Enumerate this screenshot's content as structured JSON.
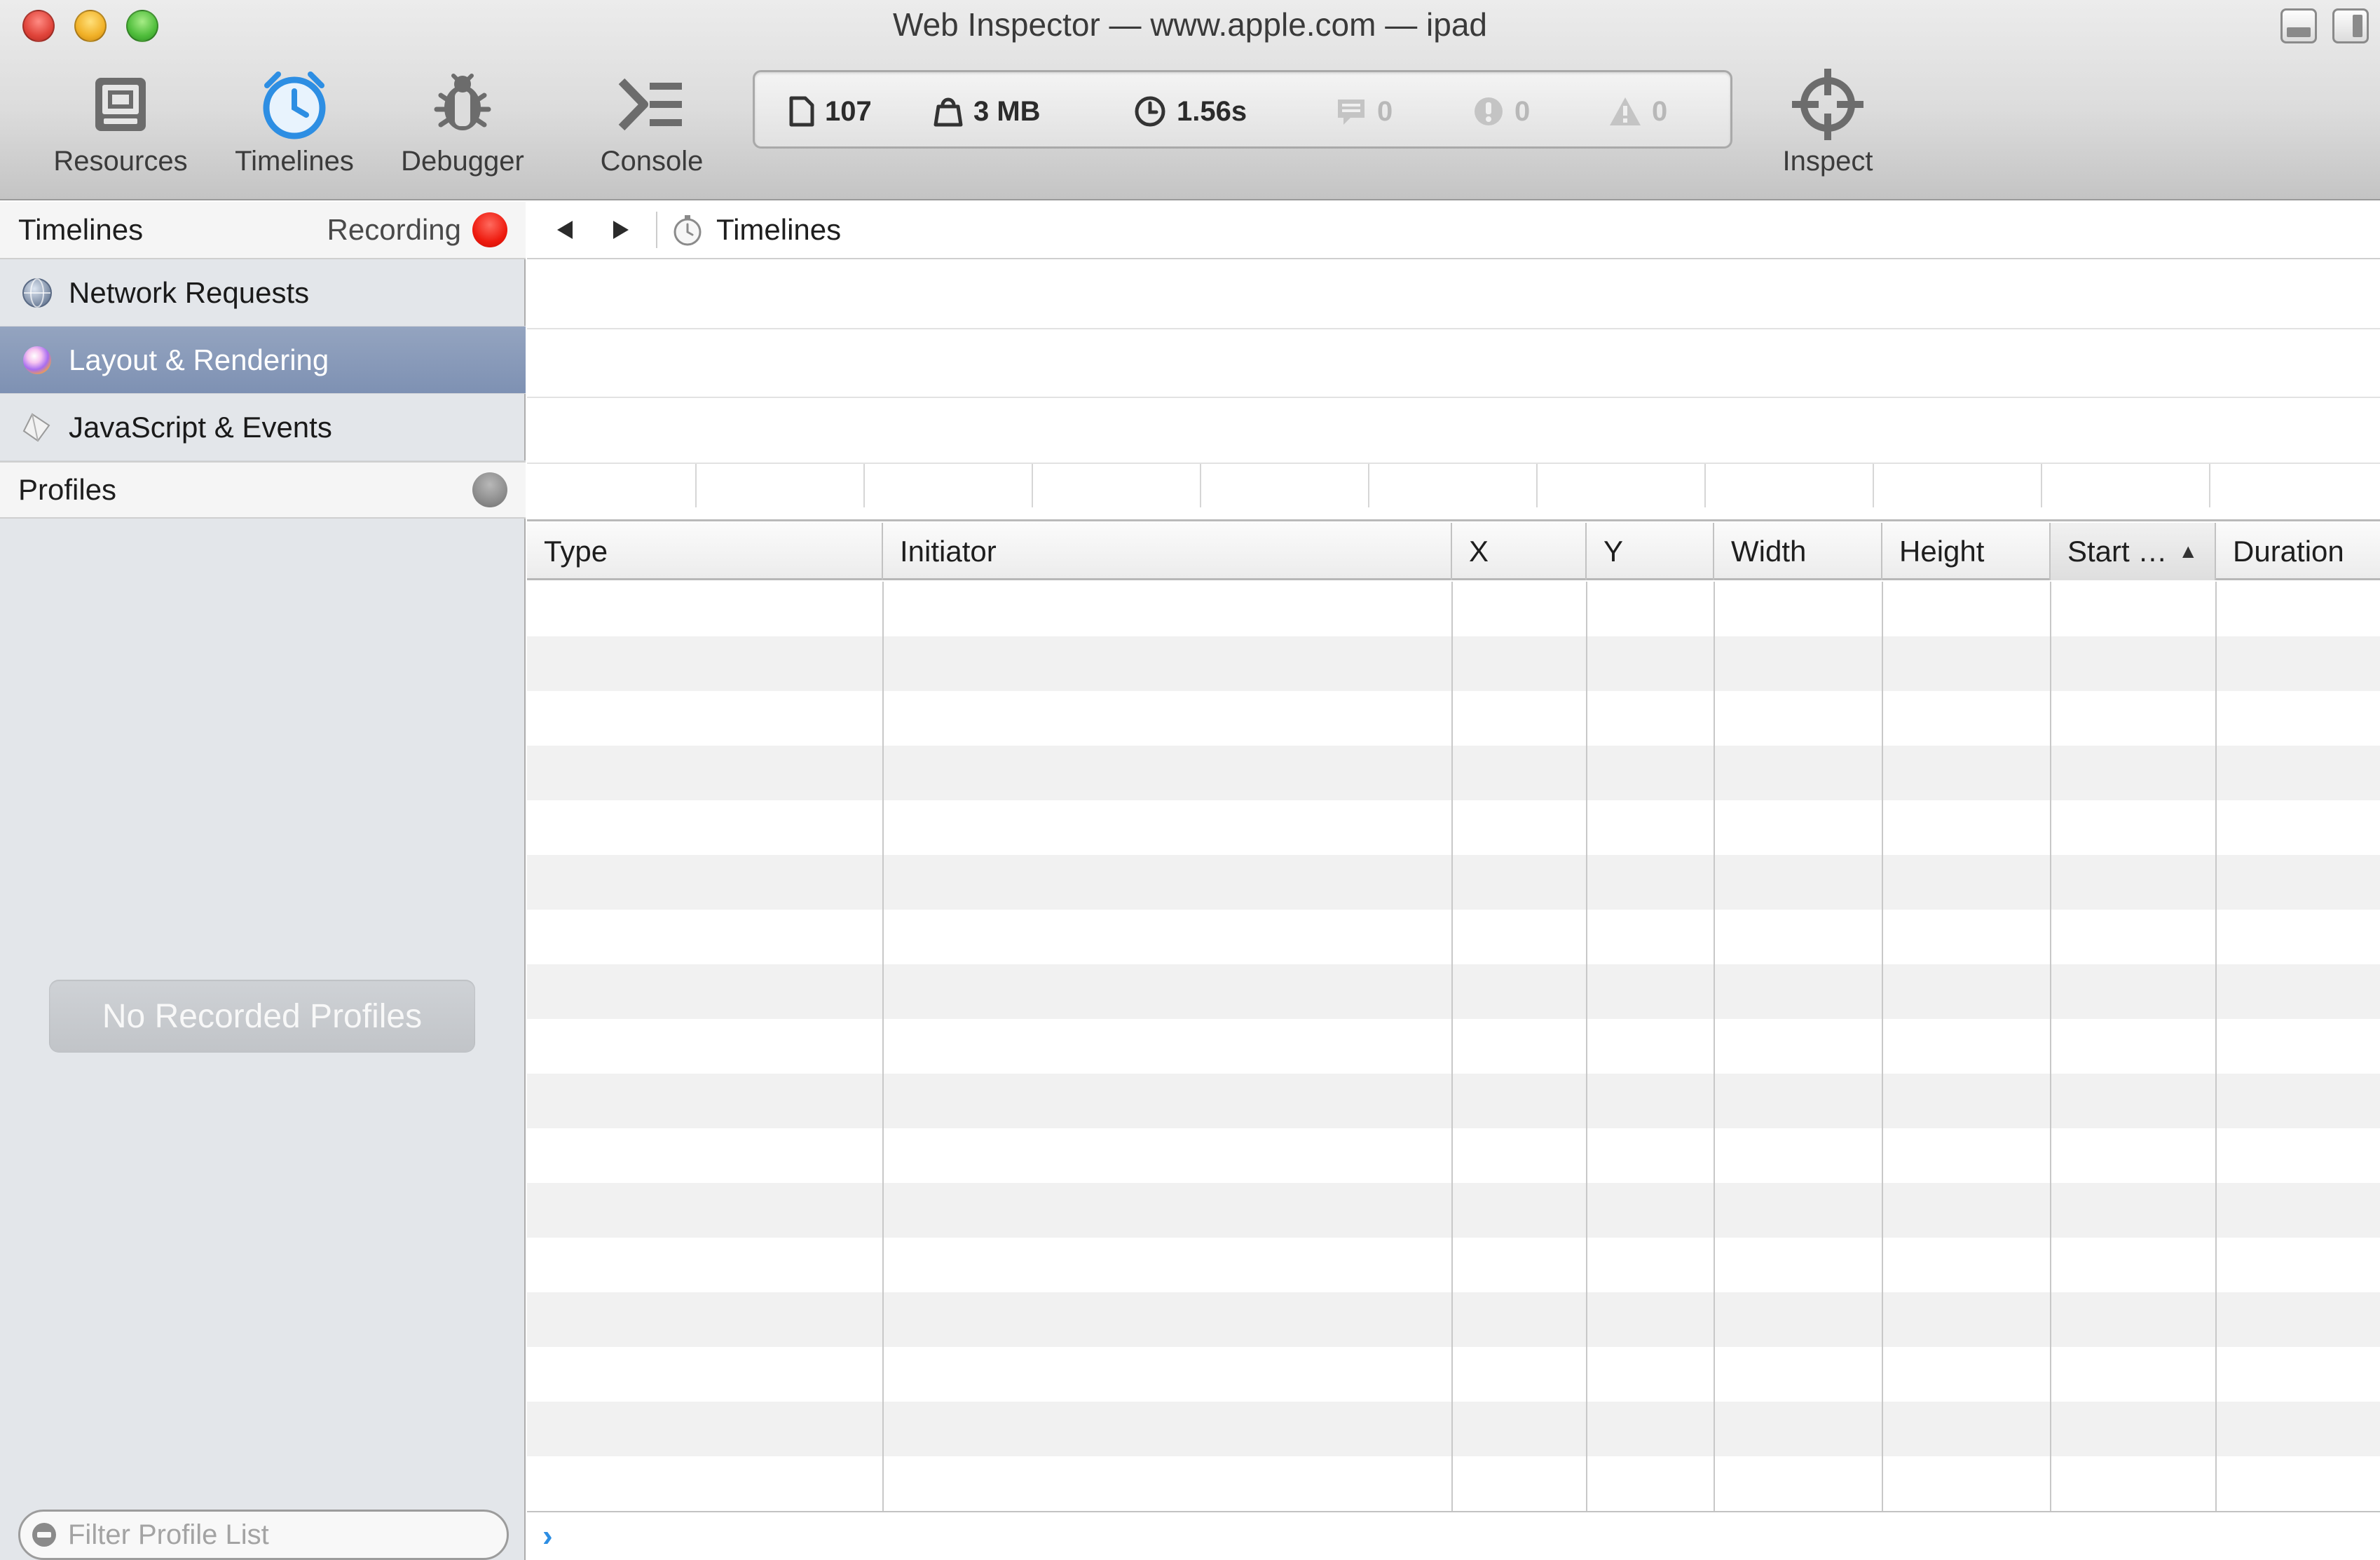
{
  "window": {
    "title": "Web Inspector — www.apple.com — ipad"
  },
  "toolbar": {
    "tabs": [
      {
        "label": "Resources",
        "icon": "resources-icon",
        "active": false
      },
      {
        "label": "Timelines",
        "icon": "timelines-icon",
        "active": true
      },
      {
        "label": "Debugger",
        "icon": "debugger-icon",
        "active": false
      },
      {
        "label": "Console",
        "icon": "console-icon",
        "active": false
      }
    ],
    "inspect_label": "Inspect",
    "dashboard": {
      "resources_count": "107",
      "resources_size": "3 MB",
      "load_time": "1.56s",
      "logs": "0",
      "errors": "0",
      "warnings": "0"
    },
    "accent_color": "#2d8ee3"
  },
  "sidebar": {
    "timelines_header": "Timelines",
    "recording_label": "Recording",
    "items": [
      {
        "label": "Network Requests",
        "icon": "network-icon",
        "selected": false
      },
      {
        "label": "Layout & Rendering",
        "icon": "layout-icon",
        "selected": true
      },
      {
        "label": "JavaScript & Events",
        "icon": "javascript-icon",
        "selected": false
      }
    ],
    "profiles_header": "Profiles",
    "empty_message": "No Recorded Profiles",
    "filter_placeholder": "Filter Profile List",
    "selection_color": "#8a9cbb"
  },
  "content": {
    "breadcrumb": "Timelines",
    "columns": [
      {
        "label": "Type"
      },
      {
        "label": "Initiator"
      },
      {
        "label": "X"
      },
      {
        "label": "Y"
      },
      {
        "label": "Width"
      },
      {
        "label": "Height"
      },
      {
        "label": "Start …",
        "sorted": "ascending"
      },
      {
        "label": "Duration"
      }
    ],
    "console_prompt": "›"
  }
}
